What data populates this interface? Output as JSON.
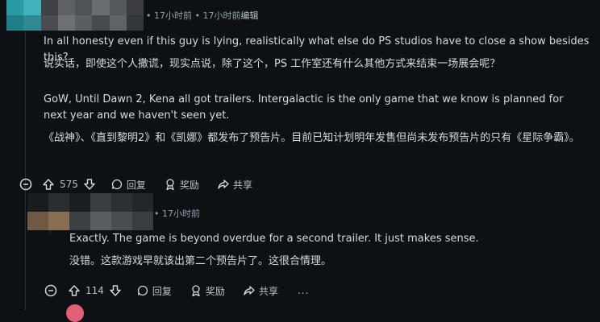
{
  "colors": {
    "background": "#0e1113",
    "text": "#d7dadc",
    "meta": "#8ba2ad",
    "accent_teal": "#27a3ad"
  },
  "comment1": {
    "meta": {
      "bullet": "•",
      "time": "17小时前",
      "separator": "•",
      "edited_time": "17小时前",
      "edited_label": "编辑"
    },
    "paragraphs": [
      "In all honesty even if this guy is lying, realistically what else do PS studios have to close a show besides this?",
      "说实话，即使这个人撒谎，现实点说，除了这个，PS 工作室还有什么其他方式来结束一场展会呢？",
      "GoW, Until Dawn 2, Kena all got trailers. Intergalactic is the only game that we know is planned for next year and we haven't seen yet.",
      "《战神》、《直到黎明2》和《凯娜》都发布了预告片。目前已知计划明年发售但尚未发布预告片的只有《星际争霸》。"
    ],
    "actions": {
      "score": "575",
      "reply": "回复",
      "award": "奖励",
      "share": "共享",
      "more": "..."
    }
  },
  "comment2": {
    "meta": {
      "bullet": "•",
      "time": "17小时前"
    },
    "paragraphs": [
      "Exactly. The game is beyond overdue for a second trailer. It just makes sense.",
      "没错。这款游戏早就该出第二个预告片了。这很合情理。"
    ],
    "actions": {
      "score": "114",
      "reply": "回复",
      "award": "奖励",
      "share": "共享",
      "more": "..."
    }
  },
  "icons": [
    "collapse-icon",
    "upvote-icon",
    "downvote-icon",
    "reply-icon",
    "award-icon",
    "share-icon",
    "more-icon"
  ]
}
